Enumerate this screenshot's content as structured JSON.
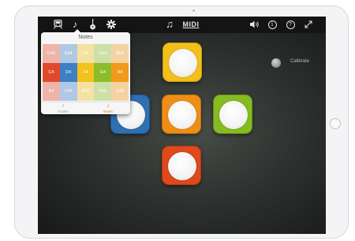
{
  "app": {
    "midi_label": "MIDI"
  },
  "toolbar": {
    "icons": [
      "train-icon",
      "music-note-icon",
      "guitar-icon",
      "gear-icon",
      "double-music-note-icon",
      "midi-icon",
      "volume-icon",
      "info-icon",
      "help-icon",
      "expand-icon"
    ],
    "info_glyph": "i",
    "help_glyph": "?",
    "note_glyph": "♪",
    "double_note_glyph": "♫"
  },
  "notes_popover": {
    "title": "Notes",
    "rows": [
      [
        "C#4",
        "Eb4",
        "F4",
        "G#4",
        "Bb4"
      ],
      [
        "C4",
        "D4",
        "F4",
        "G4",
        "A4"
      ],
      [
        "B4",
        "C#5",
        "Eb5",
        "F#5",
        "G#5"
      ]
    ],
    "column_colors": [
      "#e2492c",
      "#3f7fc4",
      "#f3c21e",
      "#8bbd2a",
      "#f29a1c"
    ],
    "tabs": [
      {
        "label": "Scales",
        "icon": "tuning-fork-icon",
        "glyph": "♪",
        "active": false
      },
      {
        "label": "Notes",
        "icon": "music-note-icon",
        "glyph": "♪",
        "active": true
      }
    ],
    "active_color": "#e8742a"
  },
  "calibrate": {
    "label": "Calibrate"
  },
  "pads": [
    {
      "name": "pad-top-yellow",
      "color": "#f2c01c",
      "border": "#c89a0c"
    },
    {
      "name": "pad-left-blue",
      "color": "#2f6fb2",
      "border": "#1f5590"
    },
    {
      "name": "pad-center-orange",
      "color": "#ef8e16",
      "border": "#c56f08"
    },
    {
      "name": "pad-right-green",
      "color": "#86bb22",
      "border": "#659016"
    },
    {
      "name": "pad-bottom-red",
      "color": "#de4a1c",
      "border": "#b5350e"
    }
  ]
}
